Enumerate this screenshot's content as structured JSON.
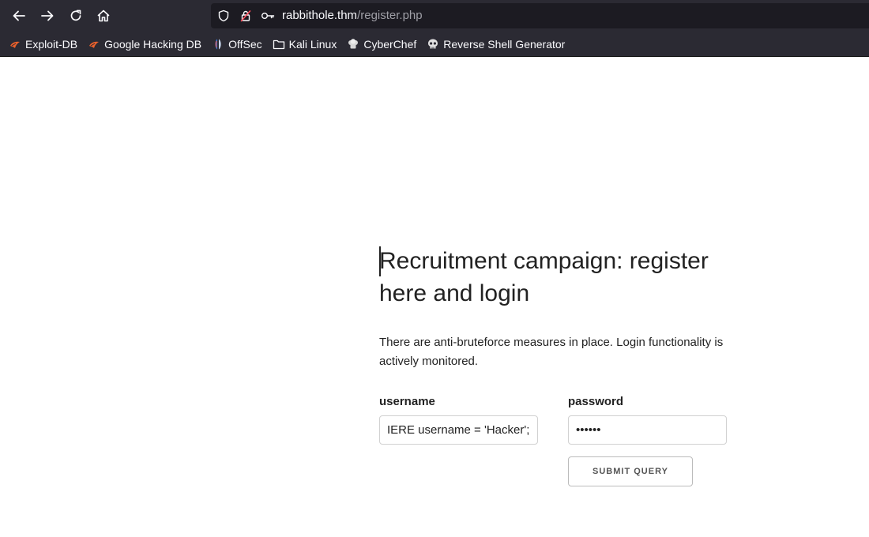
{
  "browser": {
    "url_host": "rabbithole.thm",
    "url_path": "/register.php",
    "bookmarks": [
      {
        "label": "Exploit-DB",
        "icon": "exploit-db-icon"
      },
      {
        "label": "Google Hacking DB",
        "icon": "ghdb-icon"
      },
      {
        "label": "OffSec",
        "icon": "offsec-icon"
      },
      {
        "label": "Kali Linux",
        "icon": "folder-icon"
      },
      {
        "label": "CyberChef",
        "icon": "chef-hat-icon"
      },
      {
        "label": "Reverse Shell Generator",
        "icon": "skull-icon"
      }
    ]
  },
  "page": {
    "title": "Recruitment campaign: register here and login",
    "notice": "There are anti-bruteforce measures in place. Login functionality is actively monitored.",
    "form": {
      "username_label": "username",
      "username_value": "IERE username = 'Hacker';",
      "password_label": "password",
      "password_value": "hacker",
      "submit_label": "Submit Query"
    }
  },
  "colors": {
    "chrome_bg": "#2b2a33",
    "url_bar_bg": "#1c1b22",
    "text": "#222222",
    "input_border": "#d1d1d1"
  }
}
